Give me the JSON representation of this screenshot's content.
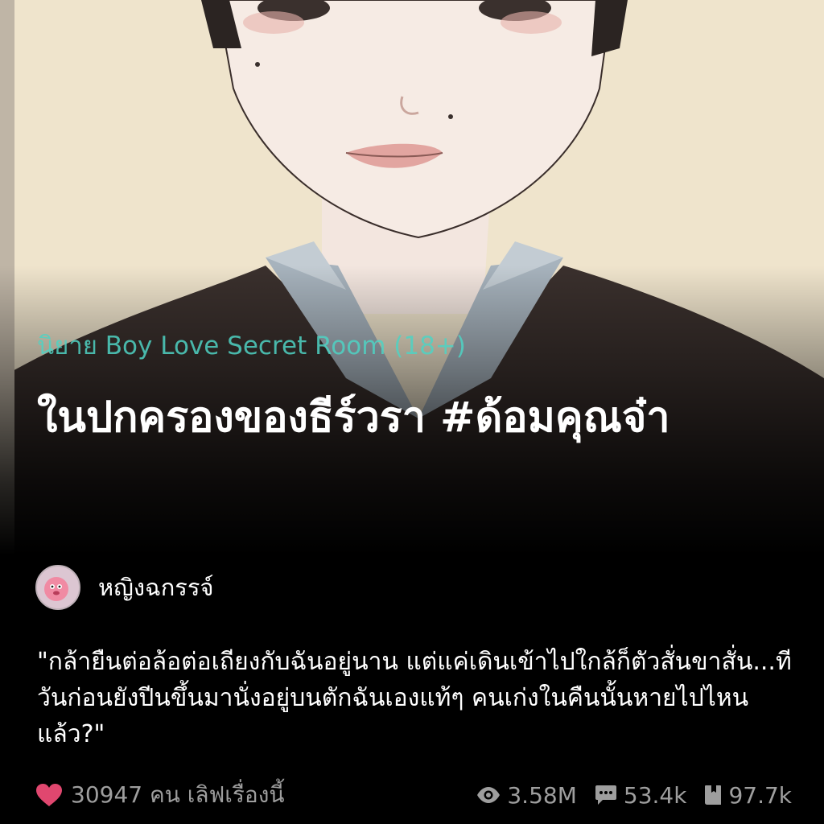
{
  "novel": {
    "category": "นิยาย Boy Love Secret Room (18+)",
    "title": "ในปกครองของธีร์วรา #ด้อมคุณจ๋า",
    "author": "หญิงฉกรรจ์",
    "synopsis": "\"กล้ายืนต่อล้อต่อเถียงกับฉันอยู่นาน แต่แค่เดินเข้าไปใกล้ก็ตัวสั่นขาสั่น...ทีวันก่อนยังปีนขึ้นมานั่งอยู่บนตักฉันเองแท้ๆ คนเก่งในคืนนั้นหายไปไหนแล้ว?\""
  },
  "stats": {
    "love_text": "30947 คน เลิฟเรื่องนี้",
    "views": "3.58M",
    "comments": "53.4k",
    "bookmarks": "97.7k"
  },
  "icons": {
    "love": "heart-icon",
    "views": "eye-icon",
    "comments": "comment-icon",
    "bookmarks": "book-icon"
  },
  "colors": {
    "category": "#4fd3c4",
    "heart": "#e0476f",
    "stats": "#9e9e9e",
    "background": "#000000"
  }
}
